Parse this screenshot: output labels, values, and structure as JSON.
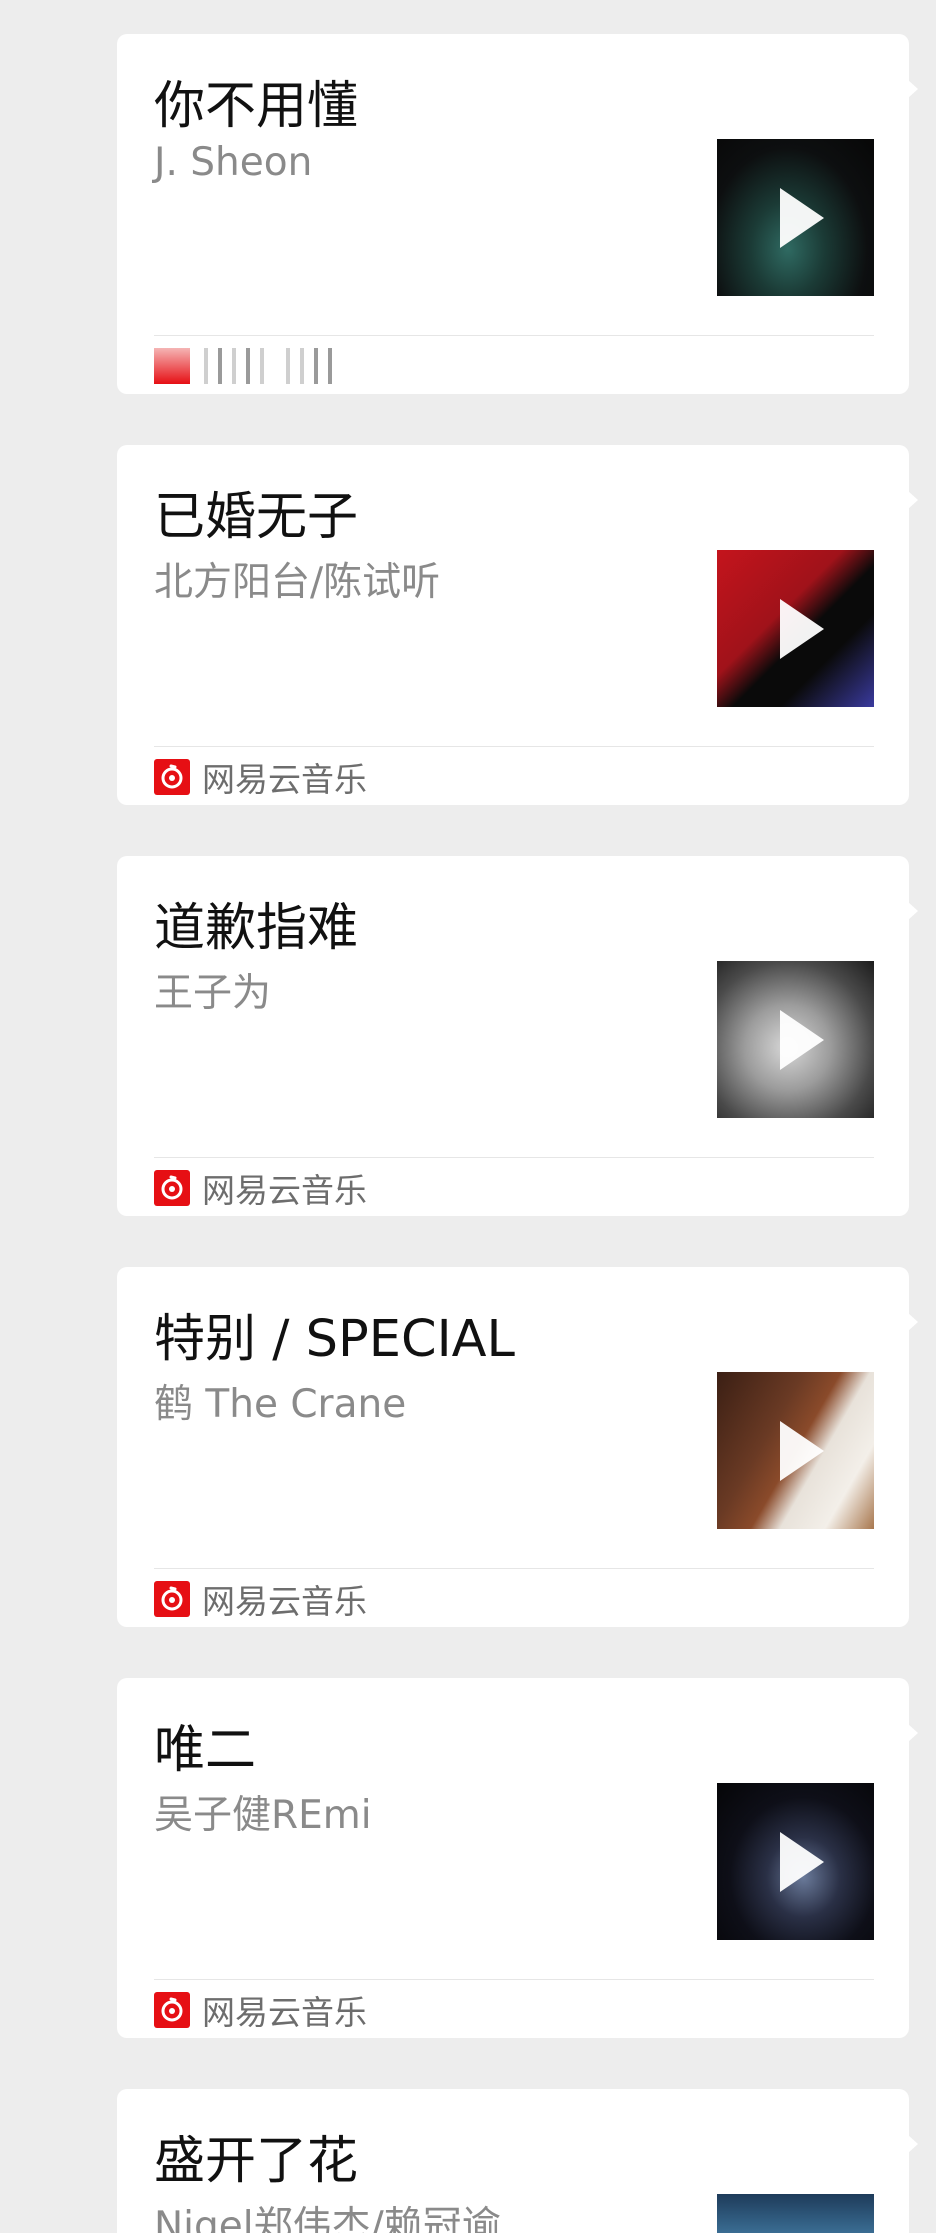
{
  "source_label": "网易云音乐",
  "cards": [
    {
      "title": "你不用懂",
      "artist": "J. Sheon",
      "source_loaded": false
    },
    {
      "title": "已婚无子",
      "artist": "北方阳台/陈试听",
      "source_loaded": true
    },
    {
      "title": "道歉指难",
      "artist": "王子为",
      "source_loaded": true
    },
    {
      "title": "特别 / SPECIAL",
      "artist": "鹤 The Crane",
      "source_loaded": true
    },
    {
      "title": "唯二",
      "artist": "吴子健REmi",
      "source_loaded": true
    },
    {
      "title": "盛开了花",
      "artist": "Nigel郑伟杰/赖冠谕",
      "source_loaded": false
    }
  ],
  "colors": {
    "background": "#ededed",
    "card": "#ffffff",
    "brand_red": "#e60f14"
  },
  "icons": {
    "play": "play-icon",
    "source": "netease-music-logo-icon"
  }
}
